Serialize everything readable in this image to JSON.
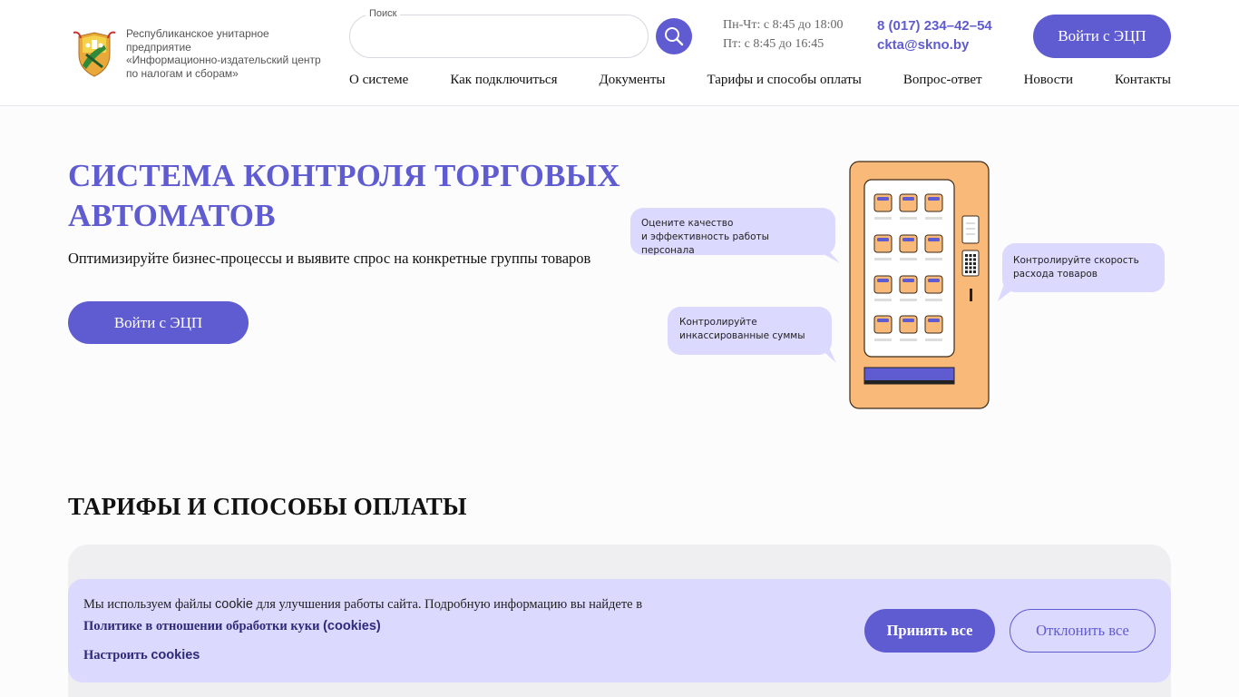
{
  "header": {
    "org_lines": [
      "Республиканское унитарное",
      "предприятие",
      "«Информационно-издательский центр",
      "по налогам и сборам»"
    ],
    "search": {
      "label": "Поиск",
      "value": "",
      "placeholder": ""
    },
    "hours": [
      "Пн-Чт: с 8:45 до 18:00",
      "Пт: с 8:45 до 16:45"
    ],
    "phone": "8 (017) 234–42–54",
    "email": "ckta@skno.by",
    "login_label": "Войти с ЭЦП"
  },
  "nav": [
    "О системе",
    "Как подключиться",
    "Документы",
    "Тарифы и способы оплаты",
    "Вопрос-ответ",
    "Новости",
    "Контакты"
  ],
  "hero": {
    "title_line1": "СИСТЕМА КОНТРОЛЯ ТОРГОВЫХ",
    "title_line2": "АВТОМАТОВ",
    "subtitle": "Оптимизируйте бизнес-процессы и выявите спрос на конкретные группы товаров",
    "login_label": "Войти с ЭЦП",
    "bubbles": {
      "quality_line1": "Оцените качество",
      "quality_line2": "и эффективность работы персонала",
      "speed_line1": "Контролируйте скорость",
      "speed_line2": "расхода товаров",
      "cash_line1": "Контролируйте",
      "cash_line2": "инкассированные суммы"
    }
  },
  "tariffs": {
    "title": "ТАРИФЫ И СПОСОБЫ ОПЛАТЫ"
  },
  "cookie": {
    "text_before": "Мы используем файлы ",
    "text_cookie": "cookie",
    "text_after": " для улучшения работы сайта. Подробную информацию вы найдете в",
    "policy_link": "Политике в отношении обработки куки ",
    "policy_link_paren": "(cookies)",
    "settings_label": "Настроить ",
    "settings_label_en": "cookies",
    "accept_label": "Принять все",
    "decline_label": "Отклонить все"
  },
  "colors": {
    "accent": "#5f5bd1",
    "bubble": "#dcd9ff",
    "machine": "#f9b978",
    "cookie_bg": "#dcd9ff"
  },
  "icons": [
    "emblem-logo",
    "search-icon"
  ]
}
